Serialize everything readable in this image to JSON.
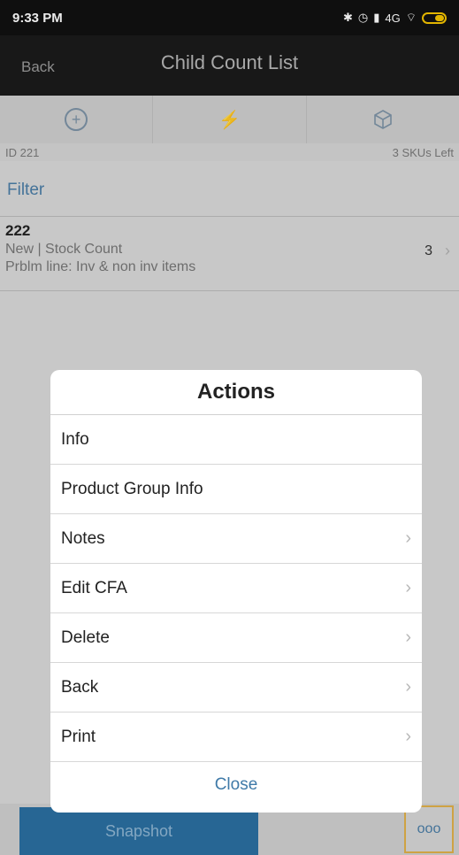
{
  "status_bar": {
    "time": "9:33 PM",
    "network": "4G",
    "icons": [
      "bluetooth-icon",
      "alarm-icon",
      "signal-icon",
      "lte-icon",
      "wifi-icon",
      "battery-icon"
    ]
  },
  "header": {
    "back_label": "Back",
    "title": "Child Count List"
  },
  "toolbar": {
    "tools": [
      "add-circle-icon",
      "bolt-icon",
      "cube-icon"
    ]
  },
  "info_row": {
    "id": "ID 221",
    "skus_left": "3 SKUs Left"
  },
  "filter": {
    "label": "Filter"
  },
  "list": {
    "items": [
      {
        "number": "222",
        "line1": "New | Stock Count",
        "line2": "Prblm line: Inv & non inv items",
        "count": "3"
      }
    ]
  },
  "bottom_bar": {
    "snapshot_label": "Snapshot",
    "more_label": "ooo"
  },
  "dialog": {
    "title": "Actions",
    "items": [
      {
        "label": "Info",
        "chevron": false
      },
      {
        "label": "Product Group Info",
        "chevron": false
      },
      {
        "label": "Notes",
        "chevron": true
      },
      {
        "label": "Edit CFA",
        "chevron": true
      },
      {
        "label": "Delete",
        "chevron": true
      },
      {
        "label": "Back",
        "chevron": true
      },
      {
        "label": "Print",
        "chevron": true
      }
    ],
    "close_label": "Close"
  },
  "colors": {
    "accent": "#3f7aa8",
    "snapshot_bg": "#2b6fa1",
    "header_bg": "#1b1b1b"
  }
}
